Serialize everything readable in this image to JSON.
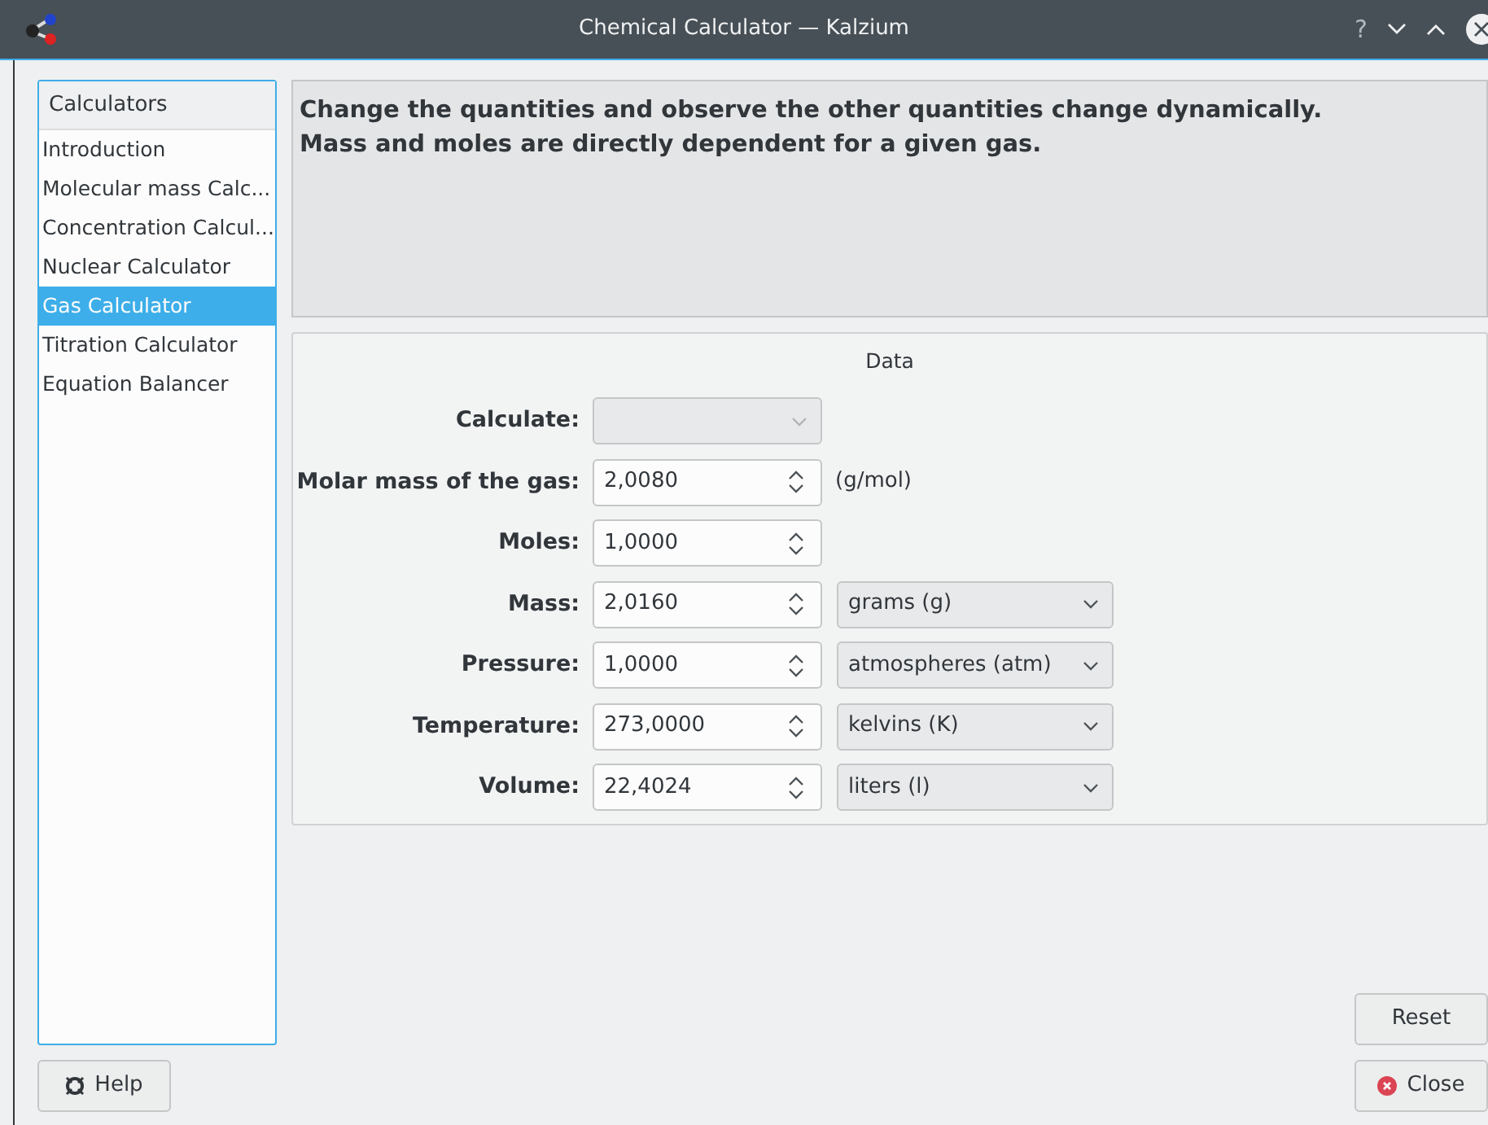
{
  "window": {
    "title": "Chemical Calculator — Kalzium",
    "controls": [
      "?"
    ]
  },
  "sidebar": {
    "header": "Calculators",
    "items": [
      {
        "label": "Introduction",
        "selected": false
      },
      {
        "label": "Molecular mass Calc...",
        "selected": false
      },
      {
        "label": "Concentration Calcul...",
        "selected": false
      },
      {
        "label": "Nuclear Calculator",
        "selected": false
      },
      {
        "label": "Gas Calculator",
        "selected": true
      },
      {
        "label": "Titration Calculator",
        "selected": false
      },
      {
        "label": "Equation Balancer",
        "selected": false
      }
    ]
  },
  "description": [
    "Change the quantities and observe the other quantities change dynamically.",
    "Mass and moles are directly dependent for a given gas."
  ],
  "data_group": {
    "title": "Data",
    "rows": [
      {
        "kind": "combo",
        "label": "Calculate:"
      },
      {
        "kind": "spin",
        "label": "Molar mass of the gas:",
        "value": "2,0080",
        "unit": {
          "kind": "text",
          "text": "(g/mol)"
        }
      },
      {
        "kind": "spin",
        "label": "Moles:",
        "value": "1,0000"
      },
      {
        "kind": "spin",
        "label": "Mass:",
        "value": "2,0160",
        "unit": {
          "kind": "select",
          "text": "grams (g)"
        }
      },
      {
        "kind": "spin",
        "label": "Pressure:",
        "value": "1,0000",
        "unit": {
          "kind": "select",
          "text": "atmospheres (atm)"
        }
      },
      {
        "kind": "spin",
        "label": "Temperature:",
        "value": "273,0000",
        "unit": {
          "kind": "select",
          "text": "kelvins (K)"
        }
      },
      {
        "kind": "spin",
        "label": "Volume:",
        "value": "22,4024",
        "unit": {
          "kind": "select",
          "text": "liters (l)"
        }
      }
    ]
  },
  "buttons": {
    "help": "Help",
    "reset": "Reset",
    "close": "Close"
  }
}
